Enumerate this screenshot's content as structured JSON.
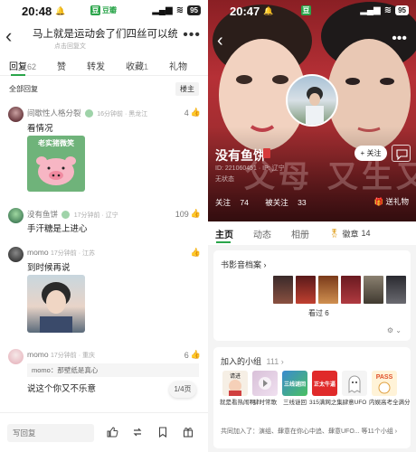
{
  "left": {
    "status": {
      "time": "20:48",
      "app_name": "豆瓣",
      "battery": "95"
    },
    "header": {
      "title": "马上就是运动会了们四丝可以统一💁了吗",
      "subtitle": "点击回复文"
    },
    "tabs": [
      {
        "label": "回复",
        "count": "62"
      },
      {
        "label": "赞",
        "count": ""
      },
      {
        "label": "转发",
        "count": ""
      },
      {
        "label": "收藏",
        "count": "1"
      },
      {
        "label": "礼物",
        "count": ""
      }
    ],
    "filter": {
      "label": "全部回复",
      "sort": "楼主"
    },
    "comments": [
      {
        "user": "间歇性人格分裂",
        "time": "16分钟前 · 黑龙江",
        "likes": "4",
        "text": "看情况",
        "sticker_text": "老实猪微笑"
      },
      {
        "user": "没有鱼饼",
        "time": "17分钟前 · 辽宁",
        "likes": "109",
        "text": "手汗糖是上进心"
      },
      {
        "user": "momo",
        "time": "17分钟前 · 江苏",
        "likes": "",
        "text": "到时候再说"
      },
      {
        "user": "momo",
        "time": "17分钟前 · 重庆",
        "likes": "6",
        "quote": "momo：那壁纸是真心",
        "text": "说这个你又不乐意"
      }
    ],
    "pager": "1/4页",
    "bottom": {
      "reply_placeholder": "写回复"
    }
  },
  "right": {
    "status": {
      "time": "20:47",
      "battery": "95"
    },
    "hero_text": "父母 又生又",
    "profile": {
      "name": "没有鱼饼",
      "id": "ID: 221060451 · IP: 辽宁",
      "state": "无状态",
      "follow": "+ 关注",
      "followers_label": "关注",
      "followers": "74",
      "followed_label": "被关注",
      "followed": "33",
      "gift": "送礼物"
    },
    "tabs": [
      {
        "label": "主页"
      },
      {
        "label": "动态"
      },
      {
        "label": "相册"
      }
    ],
    "badge_tab": {
      "label": "徽章",
      "count": "14"
    },
    "archive": {
      "title": "书影音档案 ›",
      "seen": "看过 6"
    },
    "groups": {
      "title": "加入的小组",
      "count": "111 ›",
      "items": [
        {
          "name": "就是看热闹啊",
          "tile": "请进"
        },
        {
          "name": "肆时常歌",
          "tile": ""
        },
        {
          "name": "三线谜回",
          "tile": "三线谜回"
        },
        {
          "name": "315满网之集",
          "tile": "正太牛逼"
        },
        {
          "name": "肆意UFO",
          "tile": ""
        },
        {
          "name": "内娱高考全满分",
          "tile": "PASS"
        }
      ],
      "common": "共同加入了：演组、肆意在你心中追、肆意UFO... 等11个小组 ›"
    }
  },
  "colors": {
    "accent": "#2aa54a",
    "hero": "#a8282e"
  }
}
